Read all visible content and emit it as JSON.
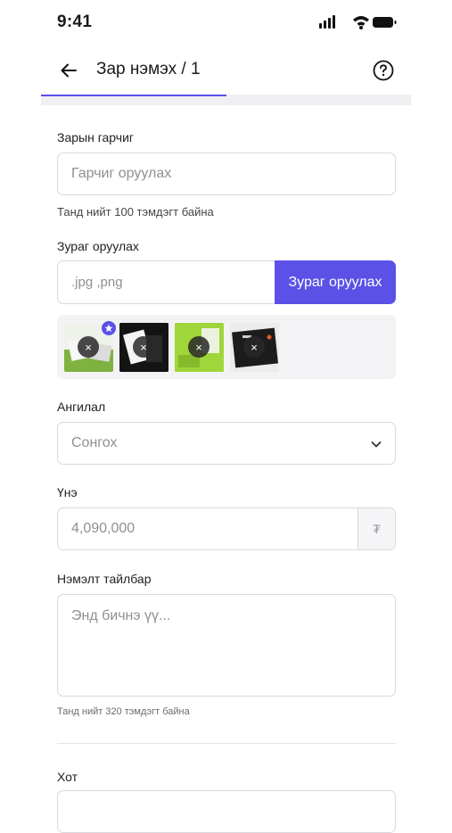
{
  "status_bar": {
    "time": "9:41",
    "icons": [
      "signal-icon",
      "wifi-icon",
      "battery-icon"
    ]
  },
  "header": {
    "title": "Зар нэмэх / 1",
    "back_icon": "arrow-left-icon",
    "help_icon": "question-circle-icon"
  },
  "progress": {
    "fraction": 0.5,
    "color": "#5b51e6"
  },
  "form": {
    "title_field": {
      "label": "Зарын гарчиг",
      "placeholder": "Гарчиг оруулах",
      "hint": "Танд нийт 100 тэмдэгт байна"
    },
    "image_upload": {
      "label": "Зураг оруулах",
      "placeholder": ".jpg ,png",
      "button_label": "Зураг оруулах",
      "remove_glyph": "×",
      "thumbnails": [
        {
          "name": "thumbnail-1",
          "primary": true,
          "icon": "star-icon"
        },
        {
          "name": "thumbnail-2",
          "primary": false
        },
        {
          "name": "thumbnail-3",
          "primary": false
        },
        {
          "name": "thumbnail-4",
          "primary": false
        }
      ]
    },
    "category": {
      "label": "Ангилал",
      "selected": "Сонгох",
      "icon": "chevron-down-icon"
    },
    "price": {
      "label": "Үнэ",
      "value": "4,090,000",
      "currency_symbol": "₮"
    },
    "description": {
      "label": "Нэмэлт тайлбар",
      "placeholder": "Энд бичнэ үү...",
      "hint": "Танд нийт 320 тэмдэгт байна"
    },
    "city": {
      "label": "Хот"
    }
  },
  "colors": {
    "accent": "#5b51e6",
    "border": "#d9d9dd",
    "thumb_bg": "#f3f3f5",
    "green_thumb": "#9fd63a"
  }
}
